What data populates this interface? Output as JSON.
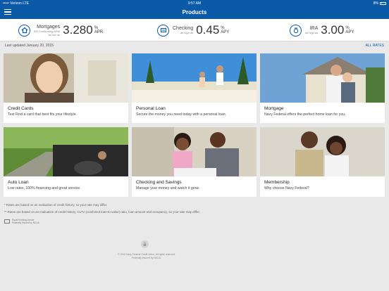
{
  "status_bar": {
    "carrier": "••••• Verizon  LTE",
    "time": "9:57 AM",
    "battery": "8%"
  },
  "navbar": {
    "title": "Products"
  },
  "rates": [
    {
      "name": "Mortgages",
      "sub": "5/5 Conforming ARM\nas low as",
      "value": "3.280",
      "unit": "%",
      "type": "APR"
    },
    {
      "name": "Checking",
      "sub": "as high as",
      "value": "0.45",
      "unit": "%",
      "type": "APY"
    },
    {
      "name": "IRA",
      "sub": "as high as",
      "value": "3.00",
      "unit": "%",
      "type": "APY"
    }
  ],
  "last_updated": "Last updated January 20, 2015",
  "all_rates": "ALL RATES",
  "cards": [
    {
      "title": "Credit Cards",
      "desc": "Test Find a card that best fits your lifestyle."
    },
    {
      "title": "Personal Loan",
      "desc": "Secure the money you need today with a personal loan."
    },
    {
      "title": "Mortgage",
      "desc": "Navy Federal offers the perfect home loan for you."
    },
    {
      "title": "Auto Loan",
      "desc": "Low rates, 100% financing and great service."
    },
    {
      "title": "Checking and Savings",
      "desc": "Manage your money and watch it grow."
    },
    {
      "title": "Membership",
      "desc": "Why choose Navy Federal?"
    }
  ],
  "footnotes": [
    "* Rates are based on an evaluation of credit history, so your rate may differ.",
    "** Rates are based on an evaluation of credit history, CLTV (combined loan-to-value) ratio, loan amount and occupancy, so your rate may differ."
  ],
  "equal_housing": "Equal Housing Lender\nFederally Insured by NCUA",
  "copyright": "© 2015 Navy Federal Credit Union. All rights reserved.\nFederally insured by NCUA.",
  "colors": {
    "brand": "#0b5aa8",
    "background": "#e9e9e9"
  }
}
